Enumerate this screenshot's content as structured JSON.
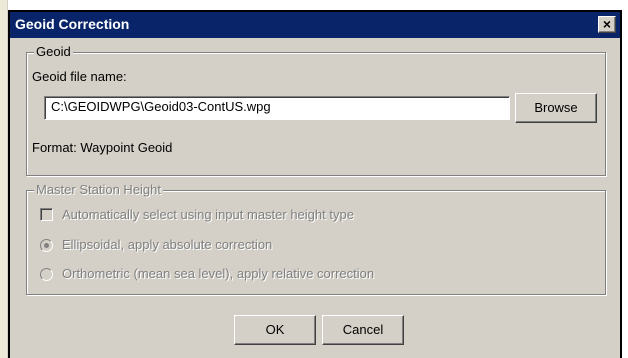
{
  "window": {
    "title": "Geoid Correction",
    "close_symbol": "×"
  },
  "geoid_group": {
    "legend": "Geoid",
    "file_label": "Geoid file name:",
    "file_value": "C:\\GEOIDWPG\\Geoid03-ContUS.wpg",
    "browse_label": "Browse",
    "format_text": "Format: Waypoint Geoid"
  },
  "master_group": {
    "legend": "Master Station Height",
    "auto_select_label": "Automatically select using input master height type",
    "auto_select_checked": false,
    "ellipsoidal_label": "Ellipsoidal, apply absolute correction",
    "ellipsoidal_selected": true,
    "orthometric_label": "Orthometric (mean sea level), apply relative correction",
    "orthometric_selected": false,
    "enabled": false
  },
  "buttons": {
    "ok_label": "OK",
    "cancel_label": "Cancel"
  },
  "colors": {
    "titlebar": "#0a246a",
    "dialog_face": "#d4d0c8",
    "disabled_text": "#808080"
  }
}
